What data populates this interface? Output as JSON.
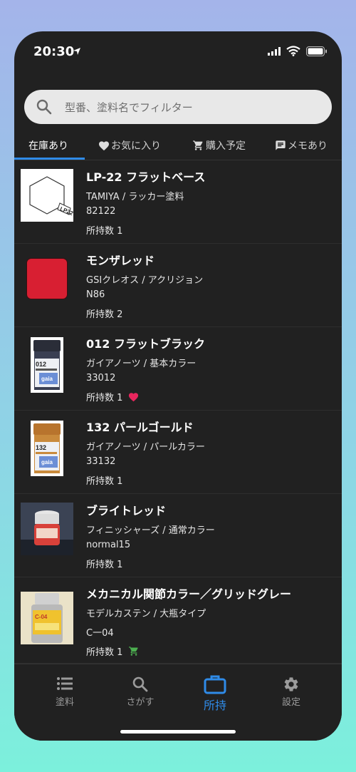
{
  "status": {
    "time": "20:30"
  },
  "search": {
    "placeholder": "型番、塗料名でフィルター"
  },
  "tabs": [
    {
      "label": "在庫あり",
      "icon": ""
    },
    {
      "label": "お気に入り",
      "icon": "heart-icon"
    },
    {
      "label": "購入予定",
      "icon": "cart-icon"
    },
    {
      "label": "メモあり",
      "icon": "memo-icon"
    }
  ],
  "items": [
    {
      "name": "LP-22 フラットベース",
      "maker": "TAMIYA / ラッカー塗料",
      "code": "82122",
      "owned": "所持数 1",
      "badge": "",
      "thumb": "hexagon-lp22"
    },
    {
      "name": "モンザレッド",
      "maker": "GSIクレオス / アクリジョン",
      "code": "N86",
      "owned": "所持数 2",
      "badge": "",
      "thumb": "red-swatch"
    },
    {
      "name": "012 フラットブラック",
      "maker": "ガイアノーツ / 基本カラー",
      "code": "33012",
      "owned": "所持数 1",
      "badge": "heart-icon",
      "thumb": "gaia-bottle-black"
    },
    {
      "name": "132 パールゴールド",
      "maker": "ガイアノーツ / パールカラー",
      "code": "33132",
      "owned": "所持数 1",
      "badge": "",
      "thumb": "gaia-bottle-gold"
    },
    {
      "name": "ブライトレッド",
      "maker": "フィニッシャーズ / 通常カラー",
      "code": "normal15",
      "owned": "所持数 1",
      "badge": "",
      "thumb": "finishers-bottle"
    },
    {
      "name": "メカニカル関節カラー／グリッドグレー",
      "maker": "モデルカステン / 大瓶タイプ",
      "code": "C一04",
      "owned": "所持数 1",
      "badge": "cart-icon",
      "thumb": "kasten-bottle"
    }
  ],
  "labels": {
    "hexagon_code": "LP22",
    "gaia_black_no": "012",
    "gaia_gold_no": "132",
    "gaia_brand": "gaia",
    "kasten_code": "C-04"
  },
  "nav": [
    {
      "label": "塗料",
      "icon": "list-icon"
    },
    {
      "label": "さがす",
      "icon": "search-icon"
    },
    {
      "label": "所持",
      "icon": "briefcase-icon"
    },
    {
      "label": "設定",
      "icon": "gear-icon"
    }
  ],
  "colors": {
    "accent": "#2f8be8",
    "heart": "#e8265d",
    "cart": "#4caf50",
    "monza_red": "#d81f32"
  }
}
